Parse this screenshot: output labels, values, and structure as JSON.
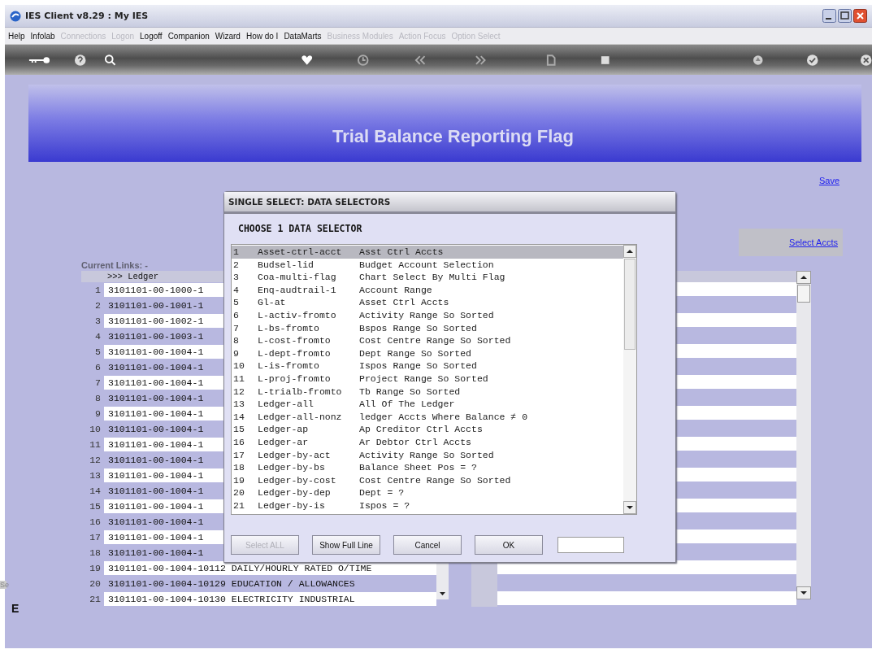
{
  "window": {
    "title": "IES Client v8.29 : My IES"
  },
  "menu": [
    {
      "label": "Help",
      "disabled": false
    },
    {
      "label": "Infolab",
      "disabled": false
    },
    {
      "label": "Connections",
      "disabled": true
    },
    {
      "label": "Logon",
      "disabled": true
    },
    {
      "label": "Logoff",
      "disabled": false
    },
    {
      "label": "Companion",
      "disabled": false
    },
    {
      "label": "Wizard",
      "disabled": false
    },
    {
      "label": "How do I",
      "disabled": false
    },
    {
      "label": "DataMarts",
      "disabled": false
    },
    {
      "label": "Business Modules",
      "disabled": true
    },
    {
      "label": "Action Focus",
      "disabled": true
    },
    {
      "label": "Option Select",
      "disabled": true
    }
  ],
  "banner": {
    "title": "Trial Balance Reporting Flag"
  },
  "save_link": "Save",
  "select_link": "Select Accts",
  "current_links_label": "Current Links: -",
  "ledger_list": {
    "header": ">>> Ledger",
    "rows": [
      {
        "number": "1",
        "text": "3101101-00-1000-1"
      },
      {
        "number": "2",
        "text": "3101101-00-1001-1"
      },
      {
        "number": "3",
        "text": "3101101-00-1002-1"
      },
      {
        "number": "4",
        "text": "3101101-00-1003-1"
      },
      {
        "number": "5",
        "text": "3101101-00-1004-1"
      },
      {
        "number": "6",
        "text": "3101101-00-1004-1"
      },
      {
        "number": "7",
        "text": "3101101-00-1004-1"
      },
      {
        "number": "8",
        "text": "3101101-00-1004-1"
      },
      {
        "number": "9",
        "text": "3101101-00-1004-1"
      },
      {
        "number": "10",
        "text": "3101101-00-1004-1"
      },
      {
        "number": "11",
        "text": "3101101-00-1004-1"
      },
      {
        "number": "12",
        "text": "3101101-00-1004-1"
      },
      {
        "number": "13",
        "text": "3101101-00-1004-1"
      },
      {
        "number": "14",
        "text": "3101101-00-1004-1"
      },
      {
        "number": "15",
        "text": "3101101-00-1004-1"
      },
      {
        "number": "16",
        "text": "3101101-00-1004-1"
      },
      {
        "number": "17",
        "text": "3101101-00-1004-1"
      },
      {
        "number": "18",
        "text": "3101101-00-1004-1"
      },
      {
        "number": "19",
        "text": "3101101-00-1004-10112 DAILY/HOURLY RATED O/TIME"
      },
      {
        "number": "20",
        "text": "3101101-00-1004-10129 EDUCATION / ALLOWANCES"
      },
      {
        "number": "21",
        "text": "3101101-00-1004-10130 ELECTRICITY INDUSTRIAL"
      }
    ]
  },
  "side_panel": {
    "label": "Se",
    "mark": "E"
  },
  "dialog": {
    "title": "SINGLE SELECT: DATA SELECTORS",
    "heading": "CHOOSE 1 DATA SELECTOR",
    "items": [
      {
        "number": "1",
        "code": "Asset-ctrl-acct",
        "description": "Asst Ctrl Accts",
        "selected": true
      },
      {
        "number": "2",
        "code": "Budsel-lid",
        "description": "Budget Account Selection",
        "selected": false
      },
      {
        "number": "3",
        "code": "Coa-multi-flag",
        "description": "Chart Select By Multi Flag",
        "selected": false
      },
      {
        "number": "4",
        "code": "Enq-audtrail-1",
        "description": "Account Range",
        "selected": false
      },
      {
        "number": "5",
        "code": "Gl-at",
        "description": "Asset Ctrl Accts",
        "selected": false
      },
      {
        "number": "6",
        "code": "L-activ-fromto",
        "description": "Activity Range So Sorted",
        "selected": false
      },
      {
        "number": "7",
        "code": "L-bs-fromto",
        "description": "Bspos Range So Sorted",
        "selected": false
      },
      {
        "number": "8",
        "code": "L-cost-fromto",
        "description": "Cost Centre Range So Sorted",
        "selected": false
      },
      {
        "number": "9",
        "code": "L-dept-fromto",
        "description": "Dept Range So Sorted",
        "selected": false
      },
      {
        "number": "10",
        "code": "L-is-fromto",
        "description": "Ispos Range So Sorted",
        "selected": false
      },
      {
        "number": "11",
        "code": "L-proj-fromto",
        "description": "Project Range So Sorted",
        "selected": false
      },
      {
        "number": "12",
        "code": "L-trialb-fromto",
        "description": "Tb Range So Sorted",
        "selected": false
      },
      {
        "number": "13",
        "code": "Ledger-all",
        "description": "All Of The Ledger",
        "selected": false
      },
      {
        "number": "14",
        "code": "Ledger-all-nonz",
        "description": "ledger Accts Where Balance ≠ 0",
        "selected": false
      },
      {
        "number": "15",
        "code": "Ledger-ap",
        "description": "Ap Creditor Ctrl Accts",
        "selected": false
      },
      {
        "number": "16",
        "code": "Ledger-ar",
        "description": "Ar Debtor Ctrl Accts",
        "selected": false
      },
      {
        "number": "17",
        "code": "Ledger-by-act",
        "description": "Activity Range So Sorted",
        "selected": false
      },
      {
        "number": "18",
        "code": "Ledger-by-bs",
        "description": "Balance Sheet Pos = ?",
        "selected": false
      },
      {
        "number": "19",
        "code": "Ledger-by-cost",
        "description": "Cost Centre Range So Sorted",
        "selected": false
      },
      {
        "number": "20",
        "code": "Ledger-by-dep",
        "description": "Dept = ?",
        "selected": false
      },
      {
        "number": "21",
        "code": "Ledger-by-is",
        "description": "Ispos = ?",
        "selected": false
      }
    ],
    "buttons": [
      {
        "label": "Select ALL",
        "disabled": true
      },
      {
        "label": "Show Full Line",
        "disabled": false
      },
      {
        "label": "Cancel",
        "disabled": false
      },
      {
        "label": "OK",
        "disabled": false
      }
    ]
  }
}
